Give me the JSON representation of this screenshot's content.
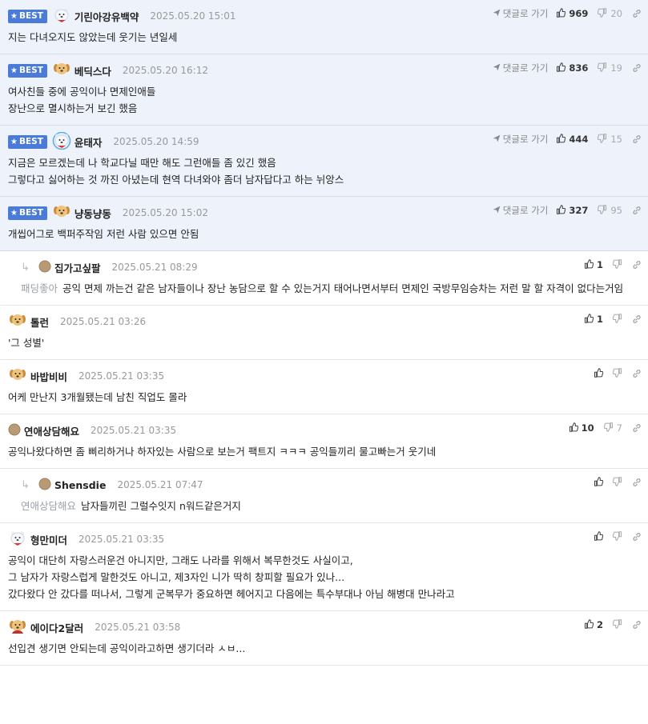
{
  "labels": {
    "best": "BEST",
    "goto": "댓글로 가기"
  },
  "comments": [
    {
      "best": true,
      "avatar": "polarbear",
      "nick": "기린아강유백약",
      "date": "2025.05.20 15:01",
      "text": "지는 다녀오지도 않았는데 웃기는 년일세",
      "likes": "969",
      "dislikes": "20",
      "goto": true
    },
    {
      "best": true,
      "avatar": "dog",
      "nick": "베딕스다",
      "date": "2025.05.20 16:12",
      "text": "여사친들 중에 공익이나 면제인애들\n장난으로 멸시하는거 보긴 했음",
      "likes": "836",
      "dislikes": "19",
      "goto": true
    },
    {
      "best": true,
      "avatar": "polarbear-blue",
      "nick": "윤태자",
      "date": "2025.05.20 14:59",
      "text": "지금은 모르겠는데 나 학교다닐 때만 해도 그런애들 좀 있긴 했음\n그렇다고 싫어하는 것 까진 아녔는데 현역 다녀와야 좀더 남자답다고 하는 뉘앙스",
      "likes": "444",
      "dislikes": "15",
      "goto": true
    },
    {
      "best": true,
      "avatar": "dog",
      "nick": "냥동냥동",
      "date": "2025.05.20 15:02",
      "text": "개씹어그로 백퍼주작임 저런 사람 있으면 안됨",
      "likes": "327",
      "dislikes": "95",
      "goto": true
    },
    {
      "reply": true,
      "avatar": "dot",
      "nick": "집가고싶팔",
      "date": "2025.05.21 08:29",
      "mention": "패딩좋아",
      "text": "공익 면제 까는건 같은 남자들이나 장난 농담으로 할 수 있는거지 태어나면서부터 면제인 국방무임승차는 저런 말 할 자격이 없다는거임",
      "likes": "1",
      "dislikes": ""
    },
    {
      "avatar": "dog",
      "nick": "톨런",
      "date": "2025.05.21 03:26",
      "text": "'그 성별'",
      "likes": "1",
      "dislikes": ""
    },
    {
      "avatar": "dog",
      "nick": "바밥비비",
      "date": "2025.05.21 03:35",
      "text": "어케 만난지 3개월됐는데 남친 직업도 몰라",
      "likes": "",
      "dislikes": ""
    },
    {
      "avatar": "dot",
      "nick": "연애상담해요",
      "date": "2025.05.21 03:35",
      "text": "공익나왔다하면 좀 삐리하거나 하자있는 사람으로 보는거 팩트지 ㅋㅋㅋ 공익들끼리 물고빠는거 웃기네",
      "likes": "10",
      "dislikes": "7"
    },
    {
      "reply": true,
      "avatar": "dot",
      "nick": "Shensdie",
      "date": "2025.05.21 07:47",
      "mention": "연애상담해요",
      "text": "남자들끼린 그럴수잇지 n워드같은거지",
      "likes": "",
      "dislikes": ""
    },
    {
      "avatar": "polarbear",
      "nick": "형만미더",
      "date": "2025.05.21 03:35",
      "text": "공익이 대단히 자랑스러운건 아니지만, 그래도 나라를 위해서 복무한것도 사실이고,\n그 남자가 자랑스럽게 말한것도 아니고, 제3자인 니가 딱히 창피할 필요가 있나...\n갔다왔다 안 갔다를 떠나서, 그렇게 군복무가 중요하면 헤어지고 다음에는 특수부대나 아님 해병대 만나라고",
      "likes": "",
      "dislikes": ""
    },
    {
      "avatar": "dog-red",
      "nick": "에이다2달러",
      "date": "2025.05.21 03:58",
      "text": "선입견 생기면 안되는데 공익이라고하면 생기더라 ㅅㅂ...",
      "likes": "2",
      "dislikes": ""
    }
  ]
}
